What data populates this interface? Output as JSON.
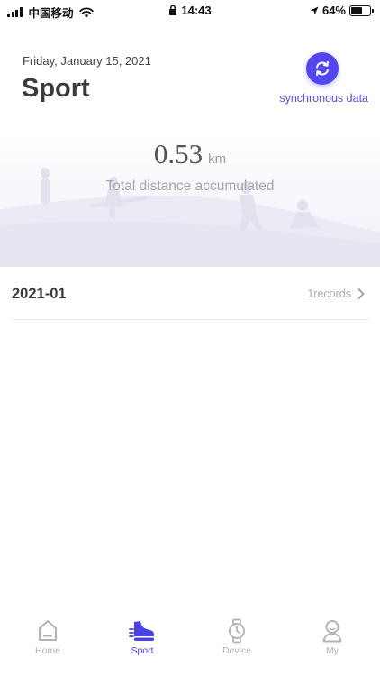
{
  "status_bar": {
    "carrier": "中国移动",
    "time": "14:43",
    "battery": "64%",
    "battery_level": 0.64
  },
  "header": {
    "date": "Friday, January 15, 2021",
    "title": "Sport",
    "sync_label": "synchronous data",
    "sync_icon": "sync-icon"
  },
  "summary": {
    "distance_value": "0.53",
    "distance_unit": "km",
    "caption": "Total distance accumulated"
  },
  "records": [
    {
      "month": "2021-01",
      "count_label": "1records"
    }
  ],
  "tabbar": {
    "tabs": [
      {
        "label": "Home",
        "icon": "home-icon",
        "active": false
      },
      {
        "label": "Sport",
        "icon": "sneaker-icon",
        "active": true
      },
      {
        "label": "Device",
        "icon": "watch-icon",
        "active": false
      },
      {
        "label": "My",
        "icon": "user-icon",
        "active": false
      }
    ]
  },
  "colors": {
    "accent": "#5146f0",
    "active_tab": "#4b3fe6",
    "inactive_tab": "#b3b3b8"
  }
}
